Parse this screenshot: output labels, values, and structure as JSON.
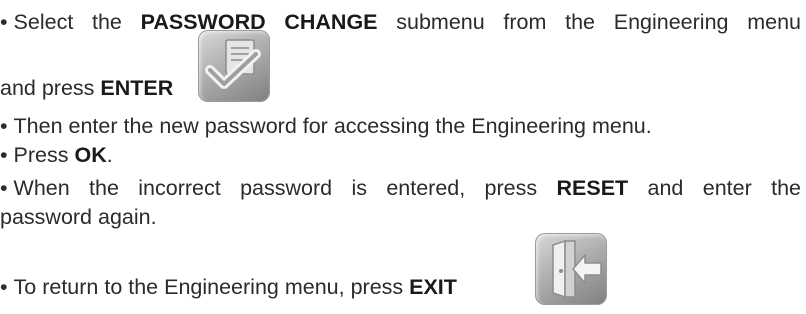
{
  "steps": [
    {
      "pre": "Select the ",
      "bold": "PASSWORD CHANGE",
      "post": " submenu from the Engineering menu",
      "cont_pre": "and press ",
      "cont_bold": "ENTER",
      "cont_post": ".",
      "icon": "enter-checkmark-icon"
    },
    {
      "text": "Then enter the new password for accessing the Engineering menu."
    },
    {
      "pre": "Press ",
      "bold": "OK",
      "post": "."
    },
    {
      "pre": "When the incorrect password is entered, press ",
      "bold": "RESET",
      "post": " and enter the",
      "cont": "password again."
    },
    {
      "pre": "To return to the Engineering menu, press ",
      "bold": "EXIT",
      "post": ".",
      "icon": "exit-door-icon"
    }
  ],
  "bullet": "•"
}
